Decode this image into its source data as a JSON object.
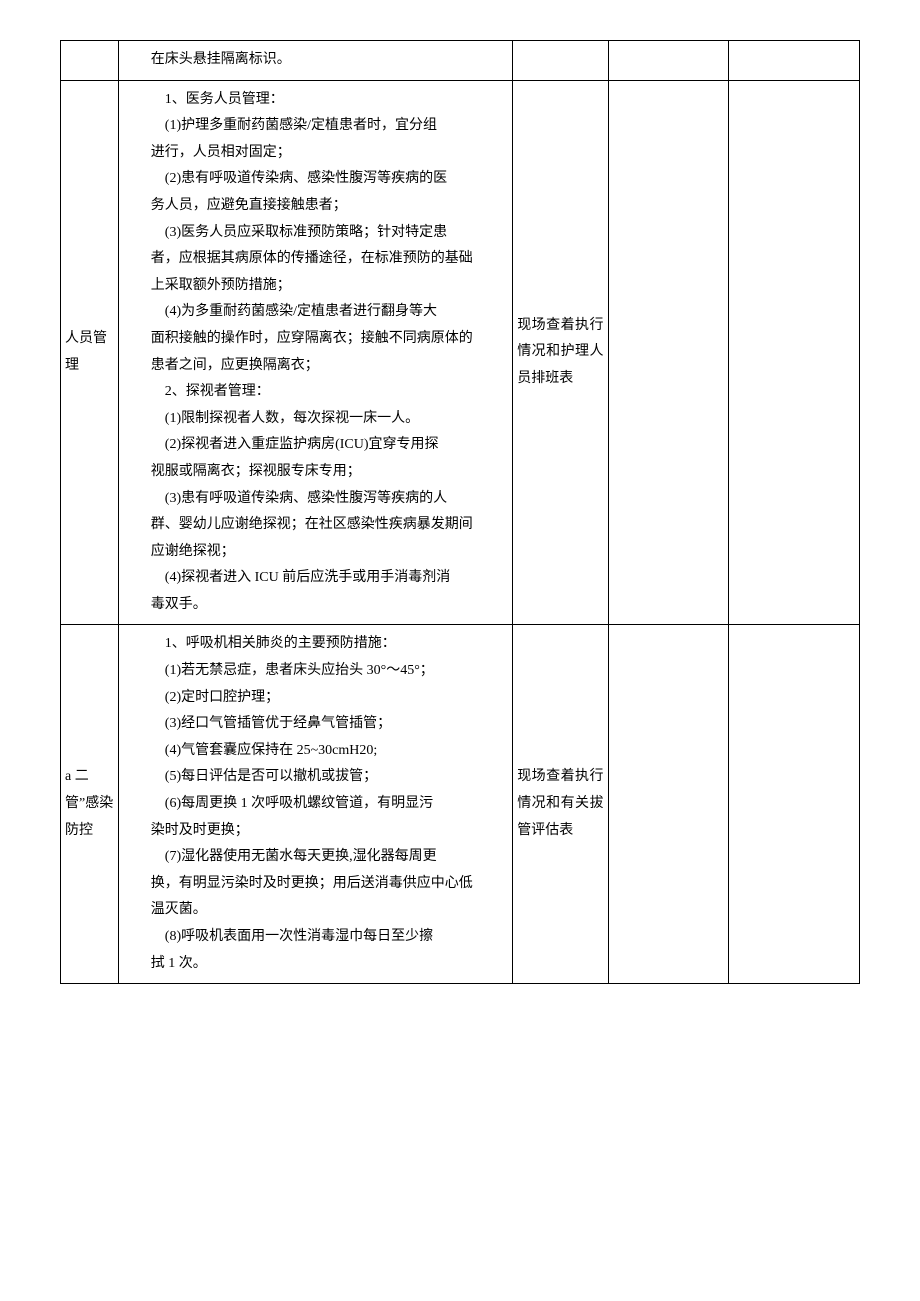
{
  "rows": [
    {
      "category": "",
      "content_lines": [
        {
          "cls": "indent",
          "txt": "在床头悬挂隔离标识。"
        }
      ],
      "method": ""
    },
    {
      "category": "人员管理",
      "content_lines": [
        {
          "cls": "subindent",
          "txt": "1、医务人员管理："
        },
        {
          "cls": "subindent",
          "txt": "(1)护理多重耐药菌感染/定植患者时，宜分组"
        },
        {
          "cls": "indent",
          "txt": "进行，人员相对固定；"
        },
        {
          "cls": "subindent",
          "txt": "(2)患有呼吸道传染病、感染性腹泻等疾病的医"
        },
        {
          "cls": "indent",
          "txt": "务人员，应避免直接接触患者；"
        },
        {
          "cls": "subindent",
          "txt": "(3)医务人员应采取标准预防策略；针对特定患"
        },
        {
          "cls": "indent",
          "txt": "者，应根据其病原体的传播途径，在标准预防的基础"
        },
        {
          "cls": "indent",
          "txt": "上采取额外预防措施；"
        },
        {
          "cls": "subindent",
          "txt": "(4)为多重耐药菌感染/定植患者进行翻身等大"
        },
        {
          "cls": "indent",
          "txt": "面积接触的操作时，应穿隔离衣；接触不同病原体的"
        },
        {
          "cls": "indent",
          "txt": "患者之间，应更换隔离衣；"
        },
        {
          "cls": "subindent",
          "txt": "2、探视者管理："
        },
        {
          "cls": "subindent",
          "txt": "(1)限制探视者人数，每次探视一床一人。"
        },
        {
          "cls": "subindent",
          "txt": "(2)探视者进入重症监护病房(ICU)宜穿专用探"
        },
        {
          "cls": "indent",
          "txt": "视服或隔离衣；探视服专床专用；"
        },
        {
          "cls": "subindent",
          "txt": "(3)患有呼吸道传染病、感染性腹泻等疾病的人"
        },
        {
          "cls": "indent",
          "txt": "群、婴幼儿应谢绝探视；在社区感染性疾病暴发期间"
        },
        {
          "cls": "indent",
          "txt": "应谢绝探视；"
        },
        {
          "cls": "subindent",
          "txt": "(4)探视者进入 ICU 前后应洗手或用手消毒剂消"
        },
        {
          "cls": "indent",
          "txt": "毒双手。"
        }
      ],
      "method": "现场查着执行情况和护理人员排班表"
    },
    {
      "category": "a 二管”感染防控",
      "content_lines": [
        {
          "cls": "subindent",
          "txt": "1、呼吸机相关肺炎的主要预防措施："
        },
        {
          "cls": "subindent",
          "txt": "(1)若无禁忌症，患者床头应抬头 30°～45°；"
        },
        {
          "cls": "subindent",
          "txt": "(2)定时口腔护理；"
        },
        {
          "cls": "subindent",
          "txt": "(3)经口气管插管优于经鼻气管插管；"
        },
        {
          "cls": "subindent",
          "txt": "(4)气管套囊应保持在 25~30cmH20;"
        },
        {
          "cls": "subindent",
          "txt": "(5)每日评估是否可以撤机或拔管；"
        },
        {
          "cls": "subindent",
          "txt": "(6)每周更换 1 次呼吸机螺纹管道，有明显污"
        },
        {
          "cls": "indent",
          "txt": "染时及时更换；"
        },
        {
          "cls": "subindent",
          "txt": "(7)湿化器使用无菌水每天更换,湿化器每周更"
        },
        {
          "cls": "indent",
          "txt": "换，有明显污染时及时更换；用后送消毒供应中心低"
        },
        {
          "cls": "indent",
          "txt": "温灭菌。"
        },
        {
          "cls": "subindent",
          "txt": "(8)呼吸机表面用一次性消毒湿巾每日至少擦"
        },
        {
          "cls": "indent",
          "txt": "拭 1 次。"
        }
      ],
      "method": "现场查着执行情况和有关拔管评估表"
    }
  ]
}
